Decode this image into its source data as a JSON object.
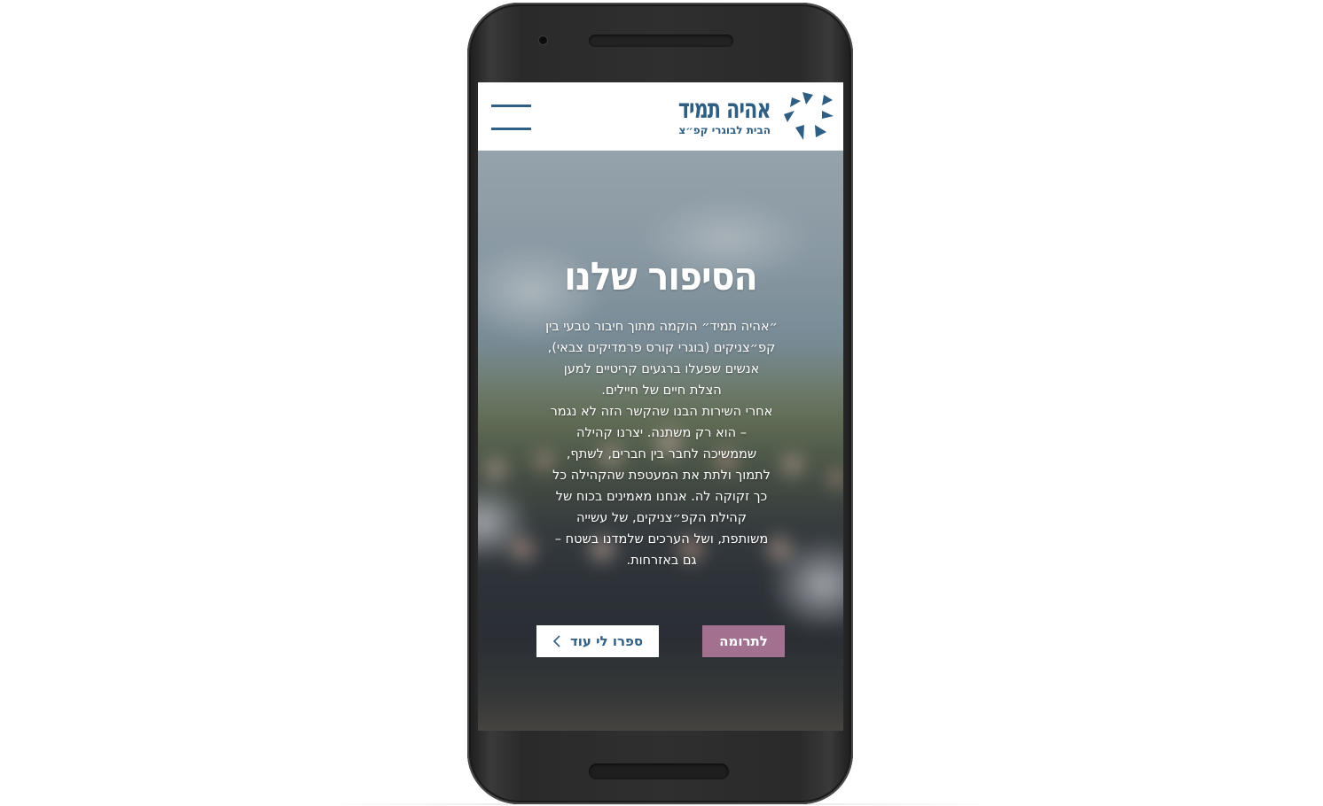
{
  "header": {
    "logo_title": "אהיה תמיד",
    "logo_subtitle": "הבית לבוגרי קפ״צ",
    "menu_icon": "hamburger-menu-icon",
    "brand_color": "#2e5e82"
  },
  "hero": {
    "title": "הסיפור שלנו",
    "paragraph_lines": [
      "״אהיה תמיד״ הוקמה מתוך חיבור טבעי בין",
      "קפ״צניקים (בוגרי קורס פרמדיקים צבאי),",
      "אנשים שפעלו ברגעים קריטיים למען",
      "הצלת חיים של חיילים.",
      "אחרי השירות הבנו שהקשר הזה לא נגמר",
      "– הוא רק משתנה. יצרנו קהילה",
      "שממשיכה לחבר בין חברים, לשתף,",
      "לתמוך ולתת את המעטפת שהקהילה כל",
      "כך זקוקה לה. אנחנו מאמינים בכוח של",
      "קהילת הקפ״צניקים, של עשייה",
      "משותפת, ושל הערכים שלמדנו בשטח –",
      "גם באזרחות."
    ],
    "donate_button": "לתרומה",
    "more_button": "ספרו לי עוד",
    "more_button_icon": "chevron-left-icon",
    "donate_color": "#a2718f"
  }
}
